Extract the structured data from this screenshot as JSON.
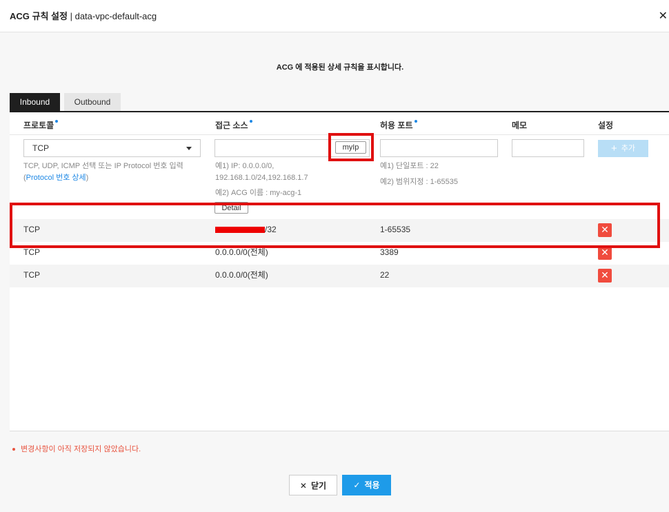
{
  "header": {
    "title_bold": "ACG 규칙 설정",
    "title_sep": "|",
    "acg_name": "data-vpc-default-acg",
    "close_symbol": "✕"
  },
  "description": "ACG 에 적용된 상세 규칙을 표시합니다.",
  "tabs": [
    {
      "label": "Inbound",
      "active": true
    },
    {
      "label": "Outbound",
      "active": false
    }
  ],
  "columns": {
    "protocol": "프로토콜",
    "source": "접근 소스",
    "port": "허용 포트",
    "memo": "메모",
    "settings": "설정"
  },
  "form": {
    "protocol_value": "TCP",
    "protocol_hint_line1": "TCP, UDP, ICMP 선택 또는 IP Protocol 번호 입력",
    "protocol_hint_open": "(",
    "protocol_hint_link": "Protocol 번호 상세",
    "protocol_hint_close": ")",
    "myip_label": "myIp",
    "source_hint_line1": "예1) IP: 0.0.0.0/0,",
    "source_hint_line2": "192.168.1.0/24,192.168.1.7",
    "source_hint_line3": "예2) ACG 이름 : my-acg-1",
    "detail_label": "Detail",
    "port_hint_line1": "예1) 단일포트 : 22",
    "port_hint_line2": "예2) 범위지정 : 1-65535",
    "add_label": "추가"
  },
  "rules": [
    {
      "protocol": "TCP",
      "source": "/32",
      "port": "1-65535"
    },
    {
      "protocol": "TCP",
      "source": "0.0.0.0/0(전체)",
      "port": "3389"
    },
    {
      "protocol": "TCP",
      "source": "0.0.0.0/0(전체)",
      "port": "22"
    }
  ],
  "warning": "변경사항이 아직 저장되지 않았습니다.",
  "footer": {
    "close_label": "닫기",
    "apply_label": "적용"
  },
  "colors": {
    "accent": "#1e9be9",
    "delete": "#f04b3e",
    "highlight_box": "#e01010"
  }
}
